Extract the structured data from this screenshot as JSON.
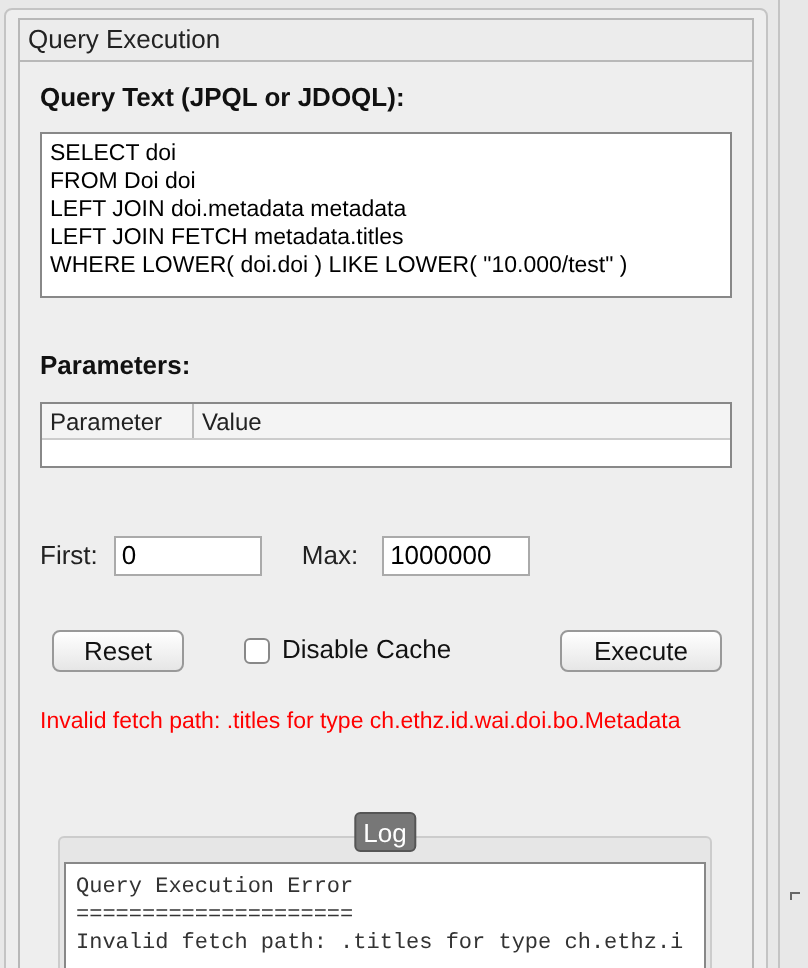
{
  "panel": {
    "title": "Query Execution"
  },
  "query": {
    "label": "Query Text (JPQL or JDOQL):",
    "lines": [
      "SELECT doi",
      "FROM Doi doi",
      "LEFT JOIN doi.metadata metadata",
      "LEFT JOIN FETCH metadata.titles",
      "WHERE LOWER( doi.doi ) LIKE LOWER( \"10.000/test\" )"
    ]
  },
  "parameters": {
    "label": "Parameters:",
    "columns": [
      "Parameter",
      "Value"
    ]
  },
  "paging": {
    "first_label": "First:",
    "first_value": "0",
    "max_label": "Max:",
    "max_value": "1000000"
  },
  "actions": {
    "reset": "Reset",
    "disable_cache": {
      "label": "Disable Cache",
      "checked": false
    },
    "execute": "Execute"
  },
  "error": "Invalid fetch path: .titles for type ch.ethz.id.wai.doi.bo.Metadata",
  "log": {
    "title": "Log",
    "lines": [
      "Query Execution Error",
      "=====================",
      "Invalid fetch path: .titles for type ch.ethz.i"
    ]
  }
}
